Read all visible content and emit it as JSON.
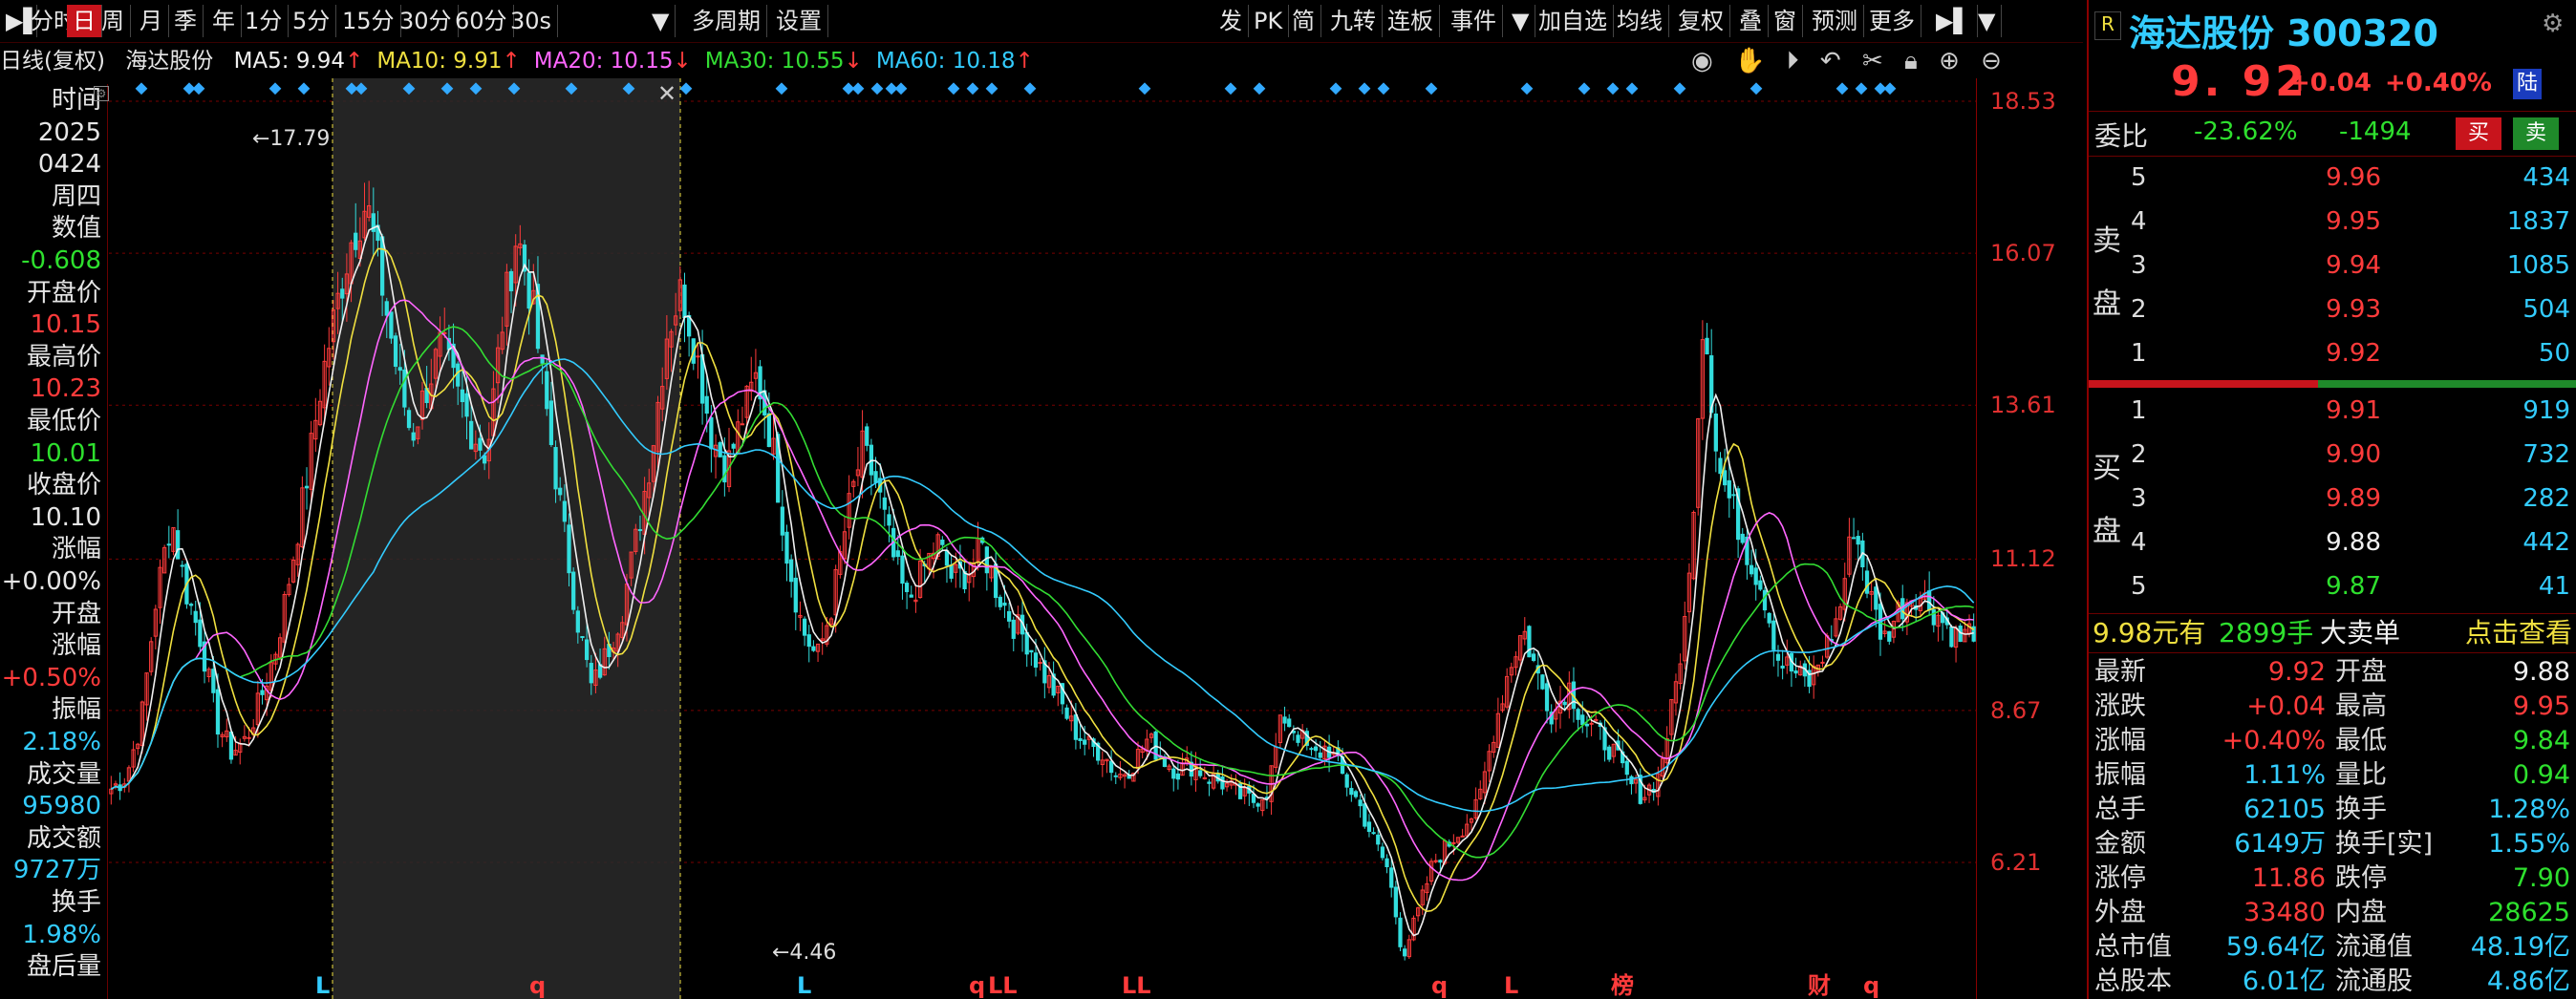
{
  "toolbar": {
    "left": [
      "分时",
      "日",
      "周",
      "月",
      "季",
      "年",
      "1分",
      "5分",
      "15分",
      "30分",
      "60分",
      "30s",
      "多周期",
      "设置"
    ],
    "active": "日",
    "right": [
      "发",
      "PK",
      "简",
      "九转",
      "连板",
      "事件",
      "加自选",
      "均线",
      "复权",
      "叠",
      "窗",
      "预测",
      "更多"
    ]
  },
  "ma_line": {
    "prefix": "日线(复权)",
    "name": "海达股份",
    "items": [
      {
        "label": "MA5: 9.94",
        "arrow": "↑",
        "color": "#f0f0f0"
      },
      {
        "label": "MA10: 9.91",
        "arrow": "↑",
        "color": "#f0e040"
      },
      {
        "label": "MA20: 10.15",
        "arrow": "↓",
        "color": "#ff66ff"
      },
      {
        "label": "MA30: 10.55",
        "arrow": "↓",
        "color": "#33dd33"
      },
      {
        "label": "MA60: 10.18",
        "arrow": "↑",
        "color": "#33ccff"
      }
    ]
  },
  "left_panel": [
    {
      "text": "时间",
      "color": "#e6e6e6"
    },
    {
      "text": "2025",
      "color": "#e6e6e6"
    },
    {
      "text": "0424",
      "color": "#e6e6e6"
    },
    {
      "text": "周四",
      "color": "#e6e6e6"
    },
    {
      "text": "数值",
      "color": "#e6e6e6"
    },
    {
      "text": "-0.608",
      "color": "#2ee02e"
    },
    {
      "text": "开盘价",
      "color": "#e6e6e6"
    },
    {
      "text": "10.15",
      "color": "#ff3b3b"
    },
    {
      "text": "最高价",
      "color": "#e6e6e6"
    },
    {
      "text": "10.23",
      "color": "#ff3b3b"
    },
    {
      "text": "最低价",
      "color": "#e6e6e6"
    },
    {
      "text": "10.01",
      "color": "#2ee02e"
    },
    {
      "text": "收盘价",
      "color": "#e6e6e6"
    },
    {
      "text": "10.10",
      "color": "#e6e6e6"
    },
    {
      "text": "涨幅",
      "color": "#e6e6e6"
    },
    {
      "text": "+0.00%",
      "color": "#e6e6e6"
    },
    {
      "text": "开盘",
      "color": "#e6e6e6"
    },
    {
      "text": "涨幅",
      "color": "#e6e6e6"
    },
    {
      "text": "+0.50%",
      "color": "#ff3b3b"
    },
    {
      "text": "振幅",
      "color": "#e6e6e6"
    },
    {
      "text": "2.18%",
      "color": "#33ccff"
    },
    {
      "text": "成交量",
      "color": "#e6e6e6"
    },
    {
      "text": "95980",
      "color": "#33ccff"
    },
    {
      "text": "成交额",
      "color": "#e6e6e6"
    },
    {
      "text": "9727万",
      "color": "#33ccff"
    },
    {
      "text": "换手",
      "color": "#e6e6e6"
    },
    {
      "text": "1.98%",
      "color": "#33ccff"
    },
    {
      "text": "盘后量",
      "color": "#e6e6e6"
    }
  ],
  "y_axis": [
    "18.53",
    "16.07",
    "13.61",
    "11.12",
    "8.67",
    "6.21"
  ],
  "chart_data": {
    "type": "candlestick",
    "ylim": [
      4.0,
      18.9
    ],
    "y_ticks": [
      18.53,
      16.07,
      13.61,
      11.12,
      8.67,
      6.21
    ],
    "annotations": [
      {
        "label": "17.79",
        "kind": "high"
      },
      {
        "label": "4.46",
        "kind": "low"
      }
    ],
    "selection_overlay": true,
    "close_series": [
      7.4,
      7.6,
      8.5,
      10.5,
      11.8,
      10.6,
      9.8,
      8.5,
      8.0,
      8.2,
      8.9,
      9.7,
      11.0,
      12.4,
      14.0,
      15.2,
      16.3,
      16.9,
      15.6,
      14.2,
      13.1,
      13.9,
      14.6,
      13.8,
      13.2,
      12.8,
      14.9,
      16.4,
      15.3,
      13.5,
      11.8,
      10.2,
      9.0,
      9.6,
      10.3,
      11.5,
      12.9,
      14.8,
      15.5,
      14.4,
      13.1,
      12.6,
      13.4,
      14.1,
      13.0,
      11.2,
      10.0,
      9.5,
      10.4,
      11.8,
      12.9,
      12.3,
      11.2,
      10.4,
      10.9,
      11.4,
      10.8,
      10.9,
      11.3,
      10.6,
      10.1,
      9.8,
      9.3,
      8.9,
      8.4,
      8.1,
      8.0,
      7.6,
      7.8,
      8.2,
      7.9,
      7.7,
      7.8,
      7.6,
      7.5,
      7.3,
      7.2,
      7.4,
      8.6,
      8.3,
      7.9,
      8.1,
      7.6,
      7.2,
      6.6,
      6.1,
      4.7,
      5.4,
      6.2,
      6.5,
      6.8,
      7.1,
      8.3,
      9.3,
      10.0,
      9.2,
      8.6,
      9.1,
      8.5,
      8.3,
      8.0,
      7.5,
      7.3,
      7.6,
      8.8,
      10.5,
      15.2,
      12.6,
      11.9,
      11.2,
      10.6,
      9.5,
      9.3,
      9.1,
      9.6,
      10.2,
      11.7,
      10.6,
      9.8,
      10.3,
      10.6,
      10.4,
      10.1,
      9.8,
      10.0
    ]
  },
  "right_panel": {
    "badge": "R",
    "stock_name": "海达股份",
    "stock_code": "300320",
    "price": "9. 92",
    "change": "+0.04",
    "change_pct": "+0.40%",
    "market_tag": "陆",
    "weibi_label": "委比",
    "weibi_pct": "-23.62%",
    "weibi_diff": "-1494",
    "buy_btn": "买",
    "sell_btn": "卖",
    "sell_group_label": [
      "卖",
      "盘"
    ],
    "buy_group_label": [
      "买",
      "盘"
    ],
    "asks": [
      {
        "level": "5",
        "price": "9.96",
        "vol": "434"
      },
      {
        "level": "4",
        "price": "9.95",
        "vol": "1837"
      },
      {
        "level": "3",
        "price": "9.94",
        "vol": "1085"
      },
      {
        "level": "2",
        "price": "9.93",
        "vol": "504"
      },
      {
        "level": "1",
        "price": "9.92",
        "vol": "50"
      }
    ],
    "bids": [
      {
        "level": "1",
        "price": "9.91",
        "vol": "919",
        "color": "#ff3b3b"
      },
      {
        "level": "2",
        "price": "9.90",
        "vol": "732",
        "color": "#ff3b3b"
      },
      {
        "level": "3",
        "price": "9.89",
        "vol": "282",
        "color": "#ff3b3b"
      },
      {
        "level": "4",
        "price": "9.88",
        "vol": "442",
        "color": "#f0f0f0"
      },
      {
        "level": "5",
        "price": "9.87",
        "vol": "41",
        "color": "#2ee02e"
      }
    ],
    "big_order": {
      "price": "9.98元有",
      "qty": "2899手",
      "type": "大卖单",
      "action": "点击查看"
    },
    "stats": [
      {
        "k1": "最新",
        "v1": "9.92",
        "c1": "#ff3b3b",
        "k2": "开盘",
        "v2": "9.88",
        "c2": "#f0f0f0"
      },
      {
        "k1": "涨跌",
        "v1": "+0.04",
        "c1": "#ff3b3b",
        "k2": "最高",
        "v2": "9.95",
        "c2": "#ff3b3b"
      },
      {
        "k1": "涨幅",
        "v1": "+0.40%",
        "c1": "#ff3b3b",
        "k2": "最低",
        "v2": "9.84",
        "c2": "#2ee02e"
      },
      {
        "k1": "振幅",
        "v1": "1.11%",
        "c1": "#33ccff",
        "k2": "量比",
        "v2": "0.94",
        "c2": "#2ee02e"
      },
      {
        "k1": "总手",
        "v1": "62105",
        "c1": "#33ccff",
        "k2": "换手",
        "v2": "1.28%",
        "c2": "#33ccff"
      },
      {
        "k1": "金额",
        "v1": "6149万",
        "c1": "#33ccff",
        "k2": "换手[实]",
        "v2": "1.55%",
        "c2": "#33ccff"
      },
      {
        "k1": "涨停",
        "v1": "11.86",
        "c1": "#ff3b3b",
        "k2": "跌停",
        "v2": "7.90",
        "c2": "#2ee02e"
      },
      {
        "k1": "外盘",
        "v1": "33480",
        "c1": "#ff3b3b",
        "k2": "内盘",
        "v2": "28625",
        "c2": "#2ee02e"
      },
      {
        "k1": "总市值",
        "v1": "59.64亿",
        "c1": "#33ccff",
        "k2": "流通值",
        "v2": "48.19亿",
        "c2": "#33ccff"
      },
      {
        "k1": "总股本",
        "v1": "6.01亿",
        "c1": "#33ccff",
        "k2": "流通股",
        "v2": "4.86亿",
        "c2": "#33ccff"
      }
    ]
  },
  "event_markers": [
    "L",
    "q",
    "qLL",
    "LL",
    "q",
    "L",
    "榜",
    "财",
    "q"
  ]
}
